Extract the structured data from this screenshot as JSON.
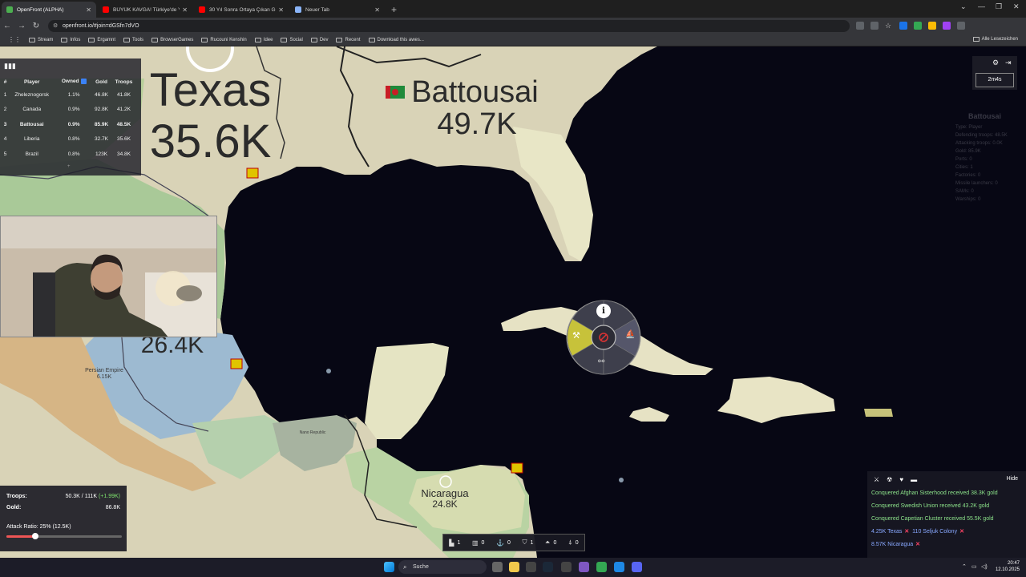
{
  "browser": {
    "tabs": [
      {
        "label": "OpenFront (ALPHA)",
        "active": true,
        "color": "#4caf50"
      },
      {
        "label": "BÜYÜK KAVGA! Türkiye'de Yaşa...",
        "active": false,
        "color": "#ff0000"
      },
      {
        "label": "30 Yıl Sonra Ortaya Çıkan Gerç...",
        "active": false,
        "color": "#ff0000"
      },
      {
        "label": "Neuer Tab",
        "active": false,
        "color": "#8ab4f8"
      }
    ],
    "url": "openfront.io/#join=dGSfn7dVO",
    "bookmarks": [
      "Stream",
      "Infos",
      "Ergamnt",
      "Tools",
      "BrowserGames",
      "Rucouni Kenshin",
      "Idee",
      "Social",
      "Dev",
      "Recent",
      "Download this awes..."
    ],
    "bookmarks_right": "Alle Lesezeichen"
  },
  "map_labels": {
    "texas": {
      "name": "Texas",
      "troops": "35.6K"
    },
    "battousai": {
      "name": "Battousai",
      "troops": "49.7K"
    },
    "west": {
      "troops": "26.4K"
    },
    "persian": {
      "name": "Persian Empire",
      "troops": "6.15K"
    },
    "nicaragua": {
      "name": "Nicaragua",
      "troops": "24.8K"
    },
    "small_center": "Nano Republic"
  },
  "leaderboard": {
    "headers": [
      "#",
      "Player",
      "Owned",
      "Gold",
      "Troops"
    ],
    "rows": [
      {
        "rank": "1",
        "player": "Zheleznogorsk",
        "owned": "1.1%",
        "gold": "46.8K",
        "troops": "41.8K"
      },
      {
        "rank": "2",
        "player": "Canada",
        "owned": "0.9%",
        "gold": "92.8K",
        "troops": "41.2K"
      },
      {
        "rank": "3",
        "player": "Battousai",
        "owned": "0.9%",
        "gold": "85.9K",
        "troops": "48.5K"
      },
      {
        "rank": "4",
        "player": "Liberia",
        "owned": "0.8%",
        "gold": "32.7K",
        "troops": "35.6K"
      },
      {
        "rank": "5",
        "player": "Brazil",
        "owned": "0.8%",
        "gold": "123K",
        "troops": "34.8K"
      }
    ],
    "highlight_rank": 3
  },
  "timer": "2m4s",
  "player_info": {
    "name": "Battousai",
    "lines": [
      "Type: Player",
      "Defending troops: 48.5K",
      "Attacking troops: 0.0K",
      "Gold: 85.9K",
      "Ports: 0",
      "Cities: 1",
      "Factories: 0",
      "Missile launchers: 0",
      "SAMs: 0",
      "Warships: 0"
    ]
  },
  "stats": {
    "troops_label": "Troops:",
    "troops_value": "50.3K / 111K",
    "troops_rate": "(+1.99K)",
    "gold_label": "Gold:",
    "gold_value": "86.8K",
    "attack_ratio": "Attack Ratio: 25% (12.5K)",
    "attack_ratio_fraction": 0.25
  },
  "units": [
    {
      "icon": "city-icon",
      "glyph": "▙",
      "count": "1"
    },
    {
      "icon": "factory-icon",
      "glyph": "▥",
      "count": "0"
    },
    {
      "icon": "port-icon",
      "glyph": "⚓",
      "count": "0"
    },
    {
      "icon": "defense-post-icon",
      "glyph": "⛉",
      "count": "1"
    },
    {
      "icon": "missile-silo-icon",
      "glyph": "⏶",
      "count": "0"
    },
    {
      "icon": "sam-icon",
      "glyph": "⍋",
      "count": "0"
    }
  ],
  "eventlog": {
    "hide_label": "Hide",
    "events": [
      {
        "text": "Conquered Afghan Sisterhood received 38.3K gold",
        "type": "green"
      },
      {
        "text": "Conquered Swedish Union received 43.2K gold",
        "type": "green"
      },
      {
        "text": "Conquered Capetian Cluster received 55.5K gold",
        "type": "green"
      },
      {
        "text": "4.25K Texas",
        "text2": "110 Seljuk Colony",
        "type": "blue"
      },
      {
        "text": "8.57K Nicaragua",
        "type": "blue"
      }
    ]
  },
  "taskbar": {
    "search": "Suche",
    "time": "20:47",
    "date": "12.10.2025"
  }
}
